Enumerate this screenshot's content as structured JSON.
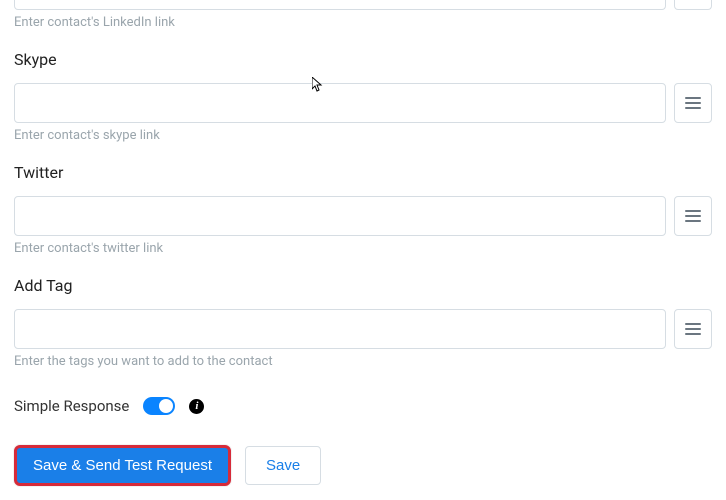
{
  "fields": {
    "linkedin": {
      "helper": "Enter contact's LinkedIn link"
    },
    "skype": {
      "label": "Skype",
      "value": "",
      "helper": "Enter contact's skype link"
    },
    "twitter": {
      "label": "Twitter",
      "value": "",
      "helper": "Enter contact's twitter link"
    },
    "addTag": {
      "label": "Add Tag",
      "value": "",
      "helper": "Enter the tags you want to add to the contact"
    }
  },
  "simpleResponse": {
    "label": "Simple Response",
    "enabled": true
  },
  "buttons": {
    "primary": "Save & Send Test Request",
    "secondary": "Save"
  }
}
